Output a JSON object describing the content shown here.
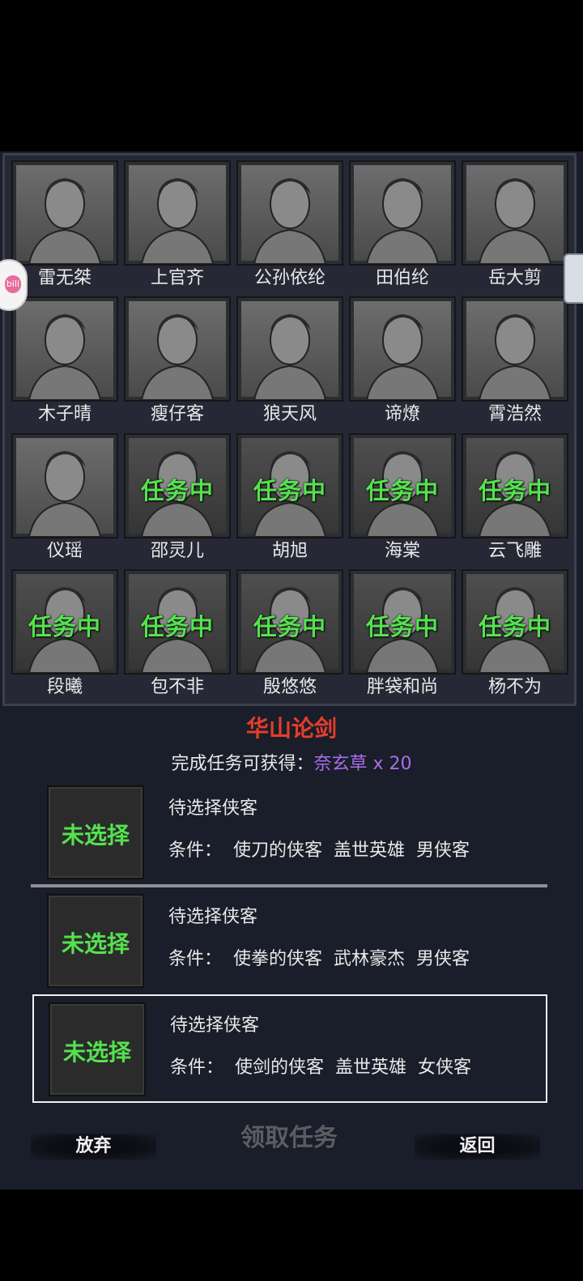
{
  "heroes": [
    {
      "name": "雷无桀",
      "busy": false
    },
    {
      "name": "上官齐",
      "busy": false
    },
    {
      "name": "公孙依纶",
      "busy": false
    },
    {
      "name": "田伯纶",
      "busy": false
    },
    {
      "name": "岳大剪",
      "busy": false
    },
    {
      "name": "木子晴",
      "busy": false
    },
    {
      "name": "瘦仔客",
      "busy": false
    },
    {
      "name": "狼天风",
      "busy": false
    },
    {
      "name": "谛燎",
      "busy": false
    },
    {
      "name": "霄浩然",
      "busy": false
    },
    {
      "name": "仪瑶",
      "busy": false
    },
    {
      "name": "邵灵儿",
      "busy": true
    },
    {
      "name": "胡旭",
      "busy": true
    },
    {
      "name": "海棠",
      "busy": true
    },
    {
      "name": "云飞雕",
      "busy": true
    },
    {
      "name": "段曦",
      "busy": true
    },
    {
      "name": "包不非",
      "busy": true
    },
    {
      "name": "殷悠悠",
      "busy": true
    },
    {
      "name": "胖袋和尚",
      "busy": true
    },
    {
      "name": "杨不为",
      "busy": true
    }
  ],
  "busy_label": "任务中",
  "side_badge_text": "bili",
  "task": {
    "title": "华山论剑",
    "reward_prefix": "完成任务可获得：",
    "reward_item": "奈玄草",
    "reward_qty": " x 20"
  },
  "slots": [
    {
      "state": "未选择",
      "title": "待选择侠客",
      "conditions": "条件：  使刀的侠客  盖世英雄  男侠客",
      "selected": false
    },
    {
      "state": "未选择",
      "title": "待选择侠客",
      "conditions": "条件：  使拳的侠客  武林豪杰  男侠客",
      "selected": false
    },
    {
      "state": "未选择",
      "title": "待选择侠客",
      "conditions": "条件：  使剑的侠客  盖世英雄  女侠客",
      "selected": true
    }
  ],
  "buttons": {
    "abandon": "放弃",
    "accept": "领取任务",
    "back": "返回"
  },
  "colors": {
    "busy_green": "#55e24f",
    "title_red": "#e53e2b",
    "reward_purple": "#a86ee9",
    "panel_bg": "#1a1d2a"
  }
}
